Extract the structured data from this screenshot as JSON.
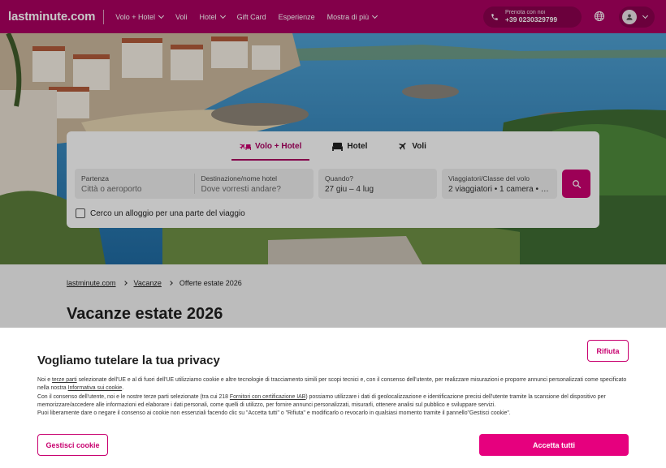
{
  "header": {
    "logo": "lastminute.com",
    "nav": [
      {
        "label": "Volo + Hotel",
        "dropdown": true
      },
      {
        "label": "Voli",
        "dropdown": false
      },
      {
        "label": "Hotel",
        "dropdown": true
      },
      {
        "label": "Gift Card",
        "dropdown": false
      },
      {
        "label": "Esperienze",
        "dropdown": false
      },
      {
        "label": "Mostra di più",
        "dropdown": true
      }
    ],
    "phone_label": "Prenota con noi",
    "phone_number": "+39 0230329799",
    "globe_icon": "globe-icon",
    "account_icon": "user-icon"
  },
  "search": {
    "tabs": [
      {
        "label": "Volo + Hotel",
        "icon": "plane-bed-icon",
        "active": true
      },
      {
        "label": "Hotel",
        "icon": "bed-icon",
        "active": false
      },
      {
        "label": "Voli",
        "icon": "plane-icon",
        "active": false
      }
    ],
    "fields": {
      "departure": {
        "label": "Partenza",
        "placeholder": "Città o aeroporto"
      },
      "destination": {
        "label": "Destinazione/nome hotel",
        "placeholder": "Dove vorresti andare?"
      },
      "when": {
        "label": "Quando?",
        "value": "27 giu – 4 lug"
      },
      "travellers": {
        "label": "Viaggiatori/Classe del volo",
        "value": "2 viaggiatori • 1 camera • …"
      }
    },
    "partial_stay_label": "Cerco un alloggio per una parte del viaggio",
    "search_icon": "search-icon"
  },
  "breadcrumb": [
    "lastminute.com",
    "Vacanze",
    "Offerte estate 2026"
  ],
  "page_title": "Vacanze estate 2026",
  "cookie": {
    "title": "Vogliamo tutelare la tua privacy",
    "p1_a": "Noi e ",
    "p1_link": "terze parti",
    "p1_b": " selezionate dell'UE e al di fuori dell'UE utilizziamo cookie e altre tecnologie di tracciamento simili per scopi tecnici e, con il consenso dell'utente, per realizzare misurazioni e proporre annunci personalizzati come specificato nella nostra ",
    "p1_link2": "Informativa sui cookie",
    "p1_c": ".",
    "p2_a": "Con il consenso dell'utente, noi e le nostre terze parti selezionate (tra cui 218 ",
    "p2_link": "Fornitori con certificazione IAB",
    "p2_b": ") possiamo utilizzare i dati di geolocalizzazione e identificazione precisi dell'utente tramite la scansione del dispositivo per memorizzare/accedere alle informazioni ed elaborare i dati personali, come quelli di utilizzo, per fornire annunci personalizzati, misurarli, ottenere analisi sul pubblico e sviluppare servizi.",
    "p3": "Puoi liberamente dare o negare il consenso ai cookie non essenziali facendo clic su \"Accetta tutti\" o \"Rifiuta\" e modificarlo o revocarlo in qualsiasi momento tramite il pannello\"Gestisci cookie\".",
    "reject_label": "Rifiuta",
    "manage_label": "Gestisci cookie",
    "accept_label": "Accetta tutti"
  },
  "colors": {
    "brand": "#a8005f",
    "accent": "#e6007e"
  }
}
